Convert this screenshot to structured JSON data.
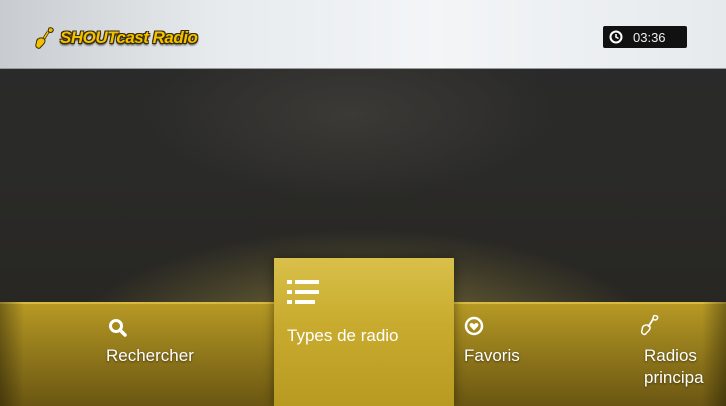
{
  "header": {
    "app_title": "SHOUTcast Radio",
    "logo_icon": "shoutcast-guitar-icon",
    "clock_icon": "clock-icon",
    "time": "03:36"
  },
  "menu": {
    "items": [
      {
        "label": "Rechercher",
        "icon": "search-icon",
        "selected": false
      },
      {
        "label": "Types de radio",
        "icon": "list-icon",
        "selected": true
      },
      {
        "label": "Favoris",
        "icon": "heart-icon",
        "selected": false
      },
      {
        "label": "Radios principa",
        "label_line1": "Radios",
        "label_line2": "principa",
        "icon": "shoutcast-guitar-icon",
        "selected": false
      }
    ]
  },
  "colors": {
    "accent_gold": "#c8ab2e",
    "logo_yellow": "#f2c200",
    "header_bg": "#e7ebee"
  }
}
